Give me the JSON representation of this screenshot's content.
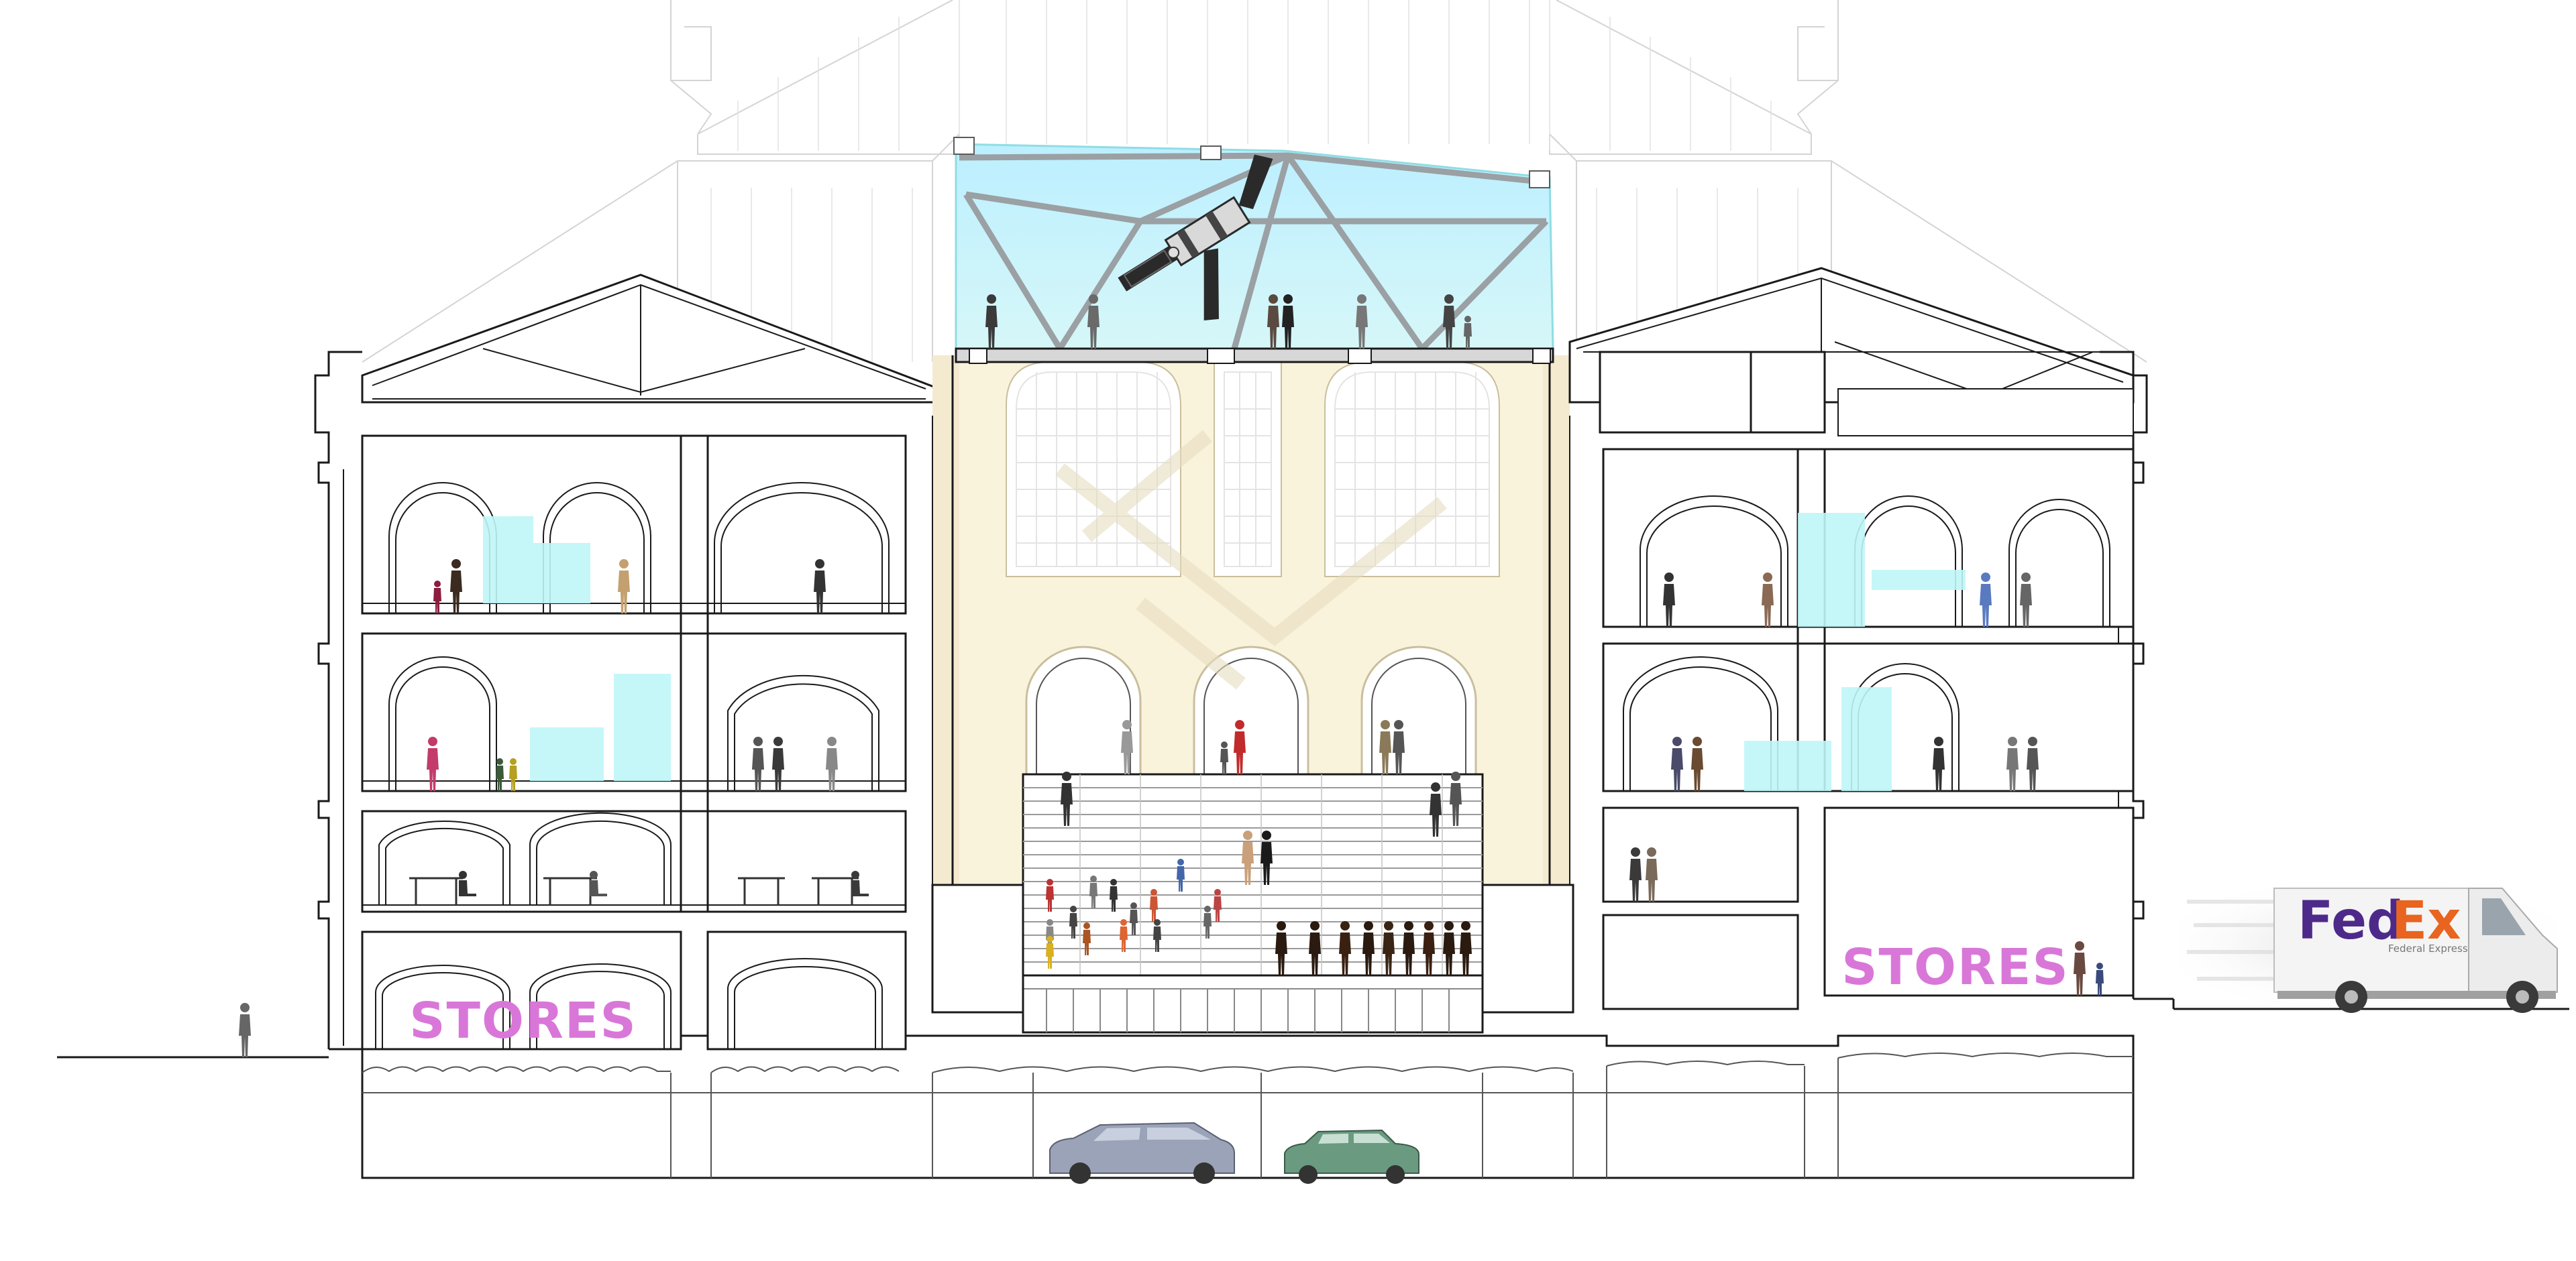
{
  "labels": {
    "stores_left": "STORES",
    "stores_right": "STORES",
    "truck_brand_fed": "Fed",
    "truck_brand_ex": "Ex",
    "truck_brand_sub": "Federal Express"
  },
  "colors": {
    "line": "#1a1a1a",
    "ghost_line": "#d0d0d0",
    "glass": "#c6f3f6",
    "glass_stroke": "#8fdde4",
    "atrium_wall": "#faf3dc",
    "exhibit_block": "#bff6f8",
    "stores_text": "#d977d9",
    "fedex_purple": "#4d2a8a",
    "fedex_orange": "#e8641f"
  },
  "icons": [
    "person-figure-icon",
    "satellite-icon",
    "car-icon",
    "delivery-truck-icon",
    "desk-chair-icon"
  ]
}
